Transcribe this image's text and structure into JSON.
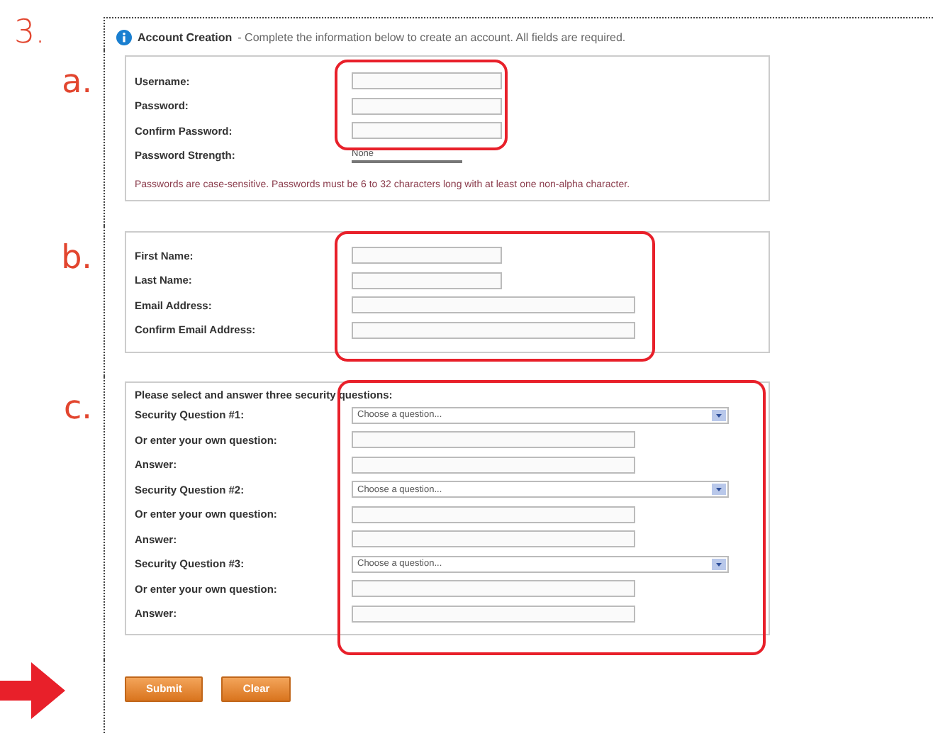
{
  "step": "3.",
  "header": {
    "title": "Account Creation",
    "description": "- Complete the information below to create an account. All fields are required."
  },
  "sections": [
    {
      "marker": "a.",
      "fields": [
        {
          "kind": "short",
          "label": "Username:"
        },
        {
          "kind": "short",
          "label": "Password:"
        },
        {
          "kind": "short",
          "label": "Confirm Password:"
        },
        {
          "kind": "meter",
          "label": "Password Strength:",
          "reading": "None",
          "level": 0
        }
      ],
      "note": "Passwords are case-sensitive. Passwords must be 6 to 32 characters long with at least one non-alpha character."
    },
    {
      "marker": "b.",
      "fields": [
        {
          "kind": "short",
          "label": "First Name:"
        },
        {
          "kind": "short",
          "label": "Last Name:"
        },
        {
          "kind": "long",
          "label": "Email Address:"
        },
        {
          "kind": "long",
          "label": "Confirm Email Address:"
        }
      ]
    },
    {
      "marker": "c.",
      "heading": "Please select and answer three security questions:",
      "fields": [
        {
          "kind": "select",
          "label": "Security Question #1:",
          "value": "Choose a question..."
        },
        {
          "kind": "long",
          "label": "Or enter your own question:"
        },
        {
          "kind": "long",
          "label": "Answer:"
        },
        {
          "kind": "select",
          "label": "Security Question #2:",
          "value": "Choose a question..."
        },
        {
          "kind": "long",
          "label": "Or enter your own question:"
        },
        {
          "kind": "long",
          "label": "Answer:"
        },
        {
          "kind": "select",
          "label": "Security Question #3:",
          "value": "Choose a question..."
        },
        {
          "kind": "long",
          "label": "Or enter your own question:"
        },
        {
          "kind": "long",
          "label": "Answer:"
        }
      ]
    }
  ],
  "buttons": [
    "Submit",
    "Clear"
  ]
}
